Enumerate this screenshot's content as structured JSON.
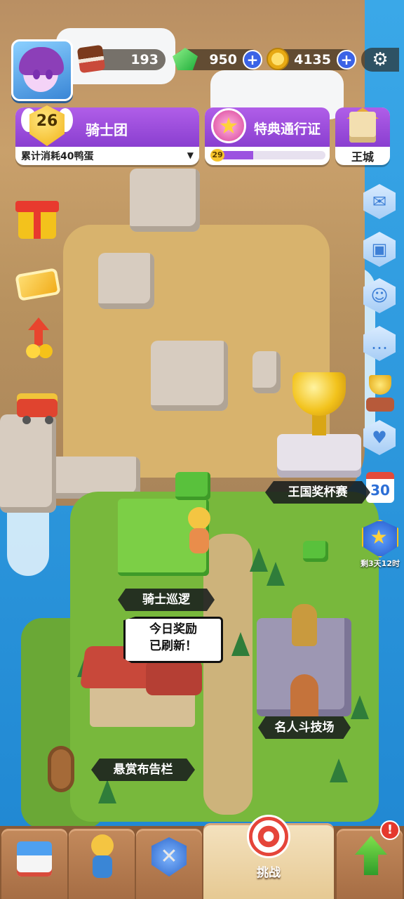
{
  "resources": {
    "cake": "193",
    "gems": "950",
    "coins": "4135"
  },
  "knights": {
    "level": "26",
    "title": "骑士团",
    "subtitle": "累计消耗40鸭蛋",
    "caret": "▼"
  },
  "pass": {
    "title": "特典通行证",
    "level": "29",
    "progress": 0.35
  },
  "citadel": {
    "title": "王城"
  },
  "side_right": {
    "calendar_day": "30",
    "season_timer": "剩3天12时"
  },
  "map_labels": {
    "kingdom_cup": "王国奖杯赛",
    "knight_patrol": "骑士巡逻",
    "celebrity_arena": "名人斗技场",
    "bounty_board": "悬赏布告栏"
  },
  "speech_bubble": {
    "line1": "今日奖励",
    "line2": "已刷新！"
  },
  "bottom_nav": {
    "challenge_label": "挑战",
    "alert": "!"
  },
  "icons": {
    "settings": "⚙",
    "plus": "+",
    "mail": "✉",
    "chat": "…",
    "heart": "♥",
    "star": "★"
  },
  "colors": {
    "panel_purple": "#9a48dc",
    "plus_blue": "#3b63e6",
    "alert_red": "#e5392d"
  }
}
